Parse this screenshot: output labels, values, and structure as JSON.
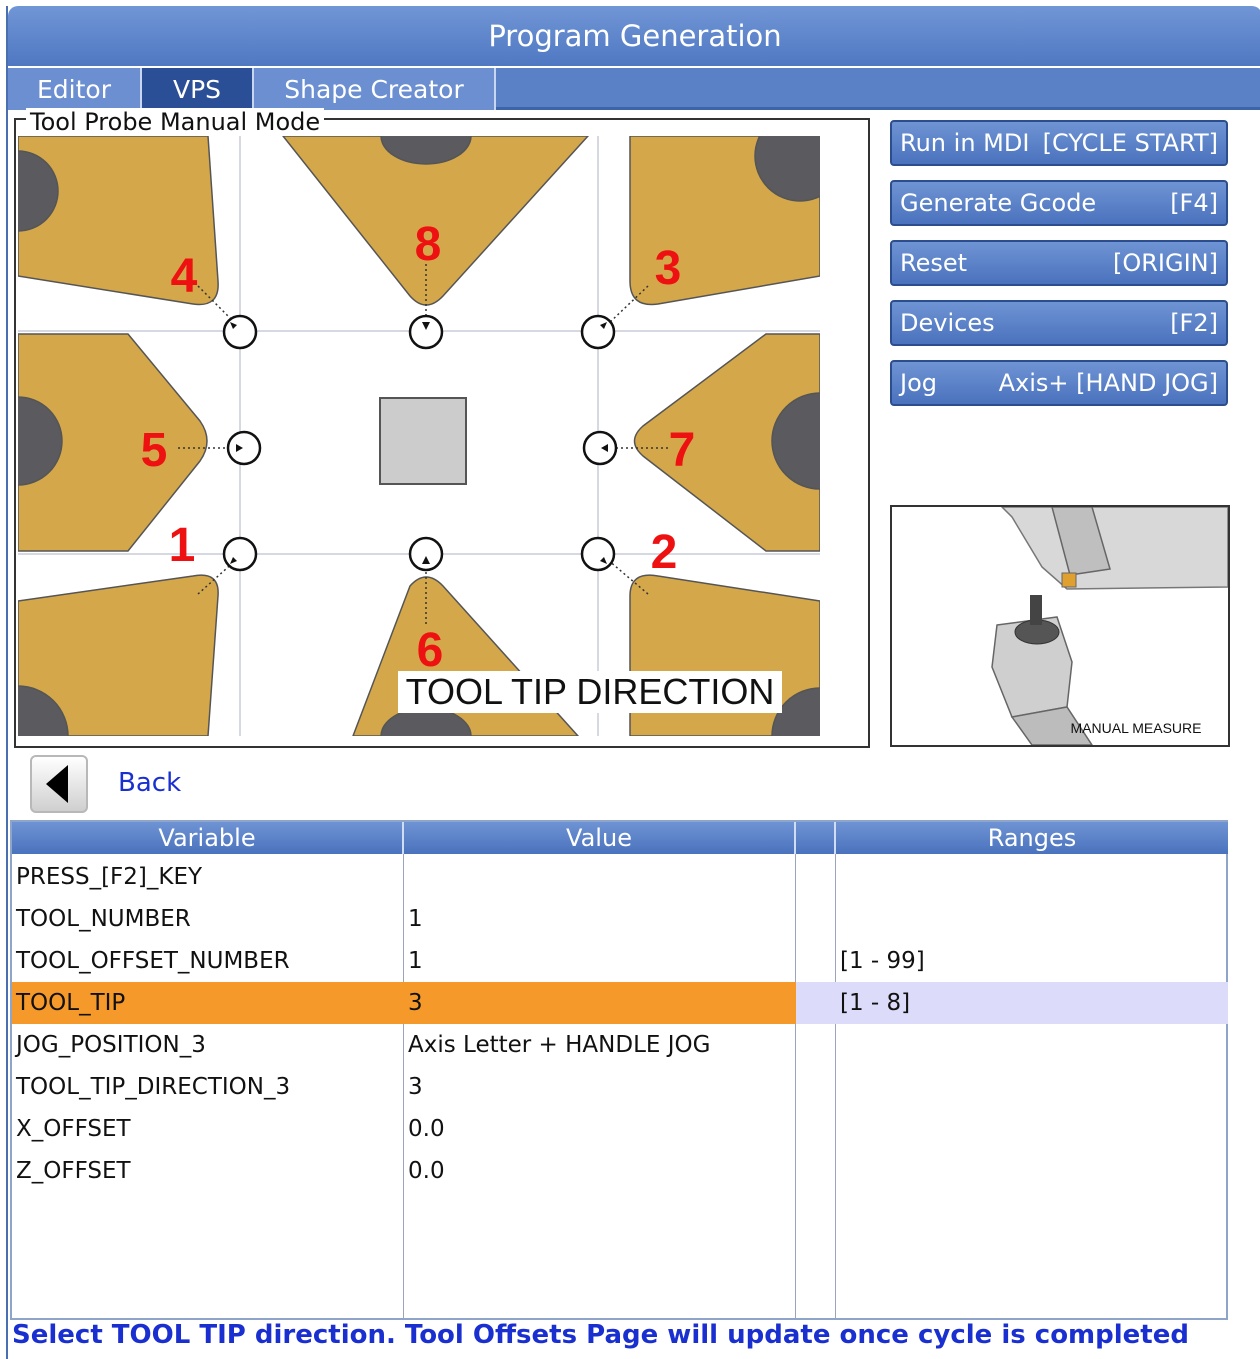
{
  "window": {
    "title": "Program Generation"
  },
  "tabs": [
    {
      "label": "Editor"
    },
    {
      "label": "VPS",
      "active": true
    },
    {
      "label": "Shape Creator"
    }
  ],
  "panel": {
    "title": "Tool Probe Manual Mode"
  },
  "diagram": {
    "caption": "TOOL TIP DIRECTION",
    "tip_numbers": [
      "1",
      "2",
      "3",
      "4",
      "5",
      "6",
      "7",
      "8"
    ],
    "insert_color": "#d4a84a",
    "number_color": "#ee1111"
  },
  "buttons": [
    {
      "label": "Run in MDI",
      "key": "[CYCLE START]"
    },
    {
      "label": "Generate Gcode",
      "key": "[F4]"
    },
    {
      "label": "Reset",
      "key": "[ORIGIN]"
    },
    {
      "label": "Devices",
      "key": "[F2]"
    },
    {
      "label": "Jog",
      "key": "Axis+ [HAND JOG]"
    }
  ],
  "photo": {
    "caption": "MANUAL MEASURE"
  },
  "nav": {
    "back_label": "Back"
  },
  "table": {
    "headers": {
      "variable": "Variable",
      "value": "Value",
      "extra": "",
      "ranges": "Ranges"
    },
    "rows": [
      {
        "variable": "PRESS_[F2]_KEY",
        "value": "",
        "range": ""
      },
      {
        "variable": "TOOL_NUMBER",
        "value": "1",
        "range": ""
      },
      {
        "variable": "TOOL_OFFSET_NUMBER",
        "value": "1",
        "range": "[1 - 99]"
      },
      {
        "variable": "TOOL_TIP",
        "value": "3",
        "range": "[1 - 8]",
        "selected": true
      },
      {
        "variable": "JOG_POSITION_3",
        "value": "Axis Letter + HANDLE JOG",
        "range": ""
      },
      {
        "variable": "TOOL_TIP_DIRECTION_3",
        "value": "3",
        "range": ""
      },
      {
        "variable": "X_OFFSET",
        "value": "0.0",
        "range": ""
      },
      {
        "variable": "Z_OFFSET",
        "value": "0.0",
        "range": ""
      }
    ]
  },
  "status": {
    "text": "Select TOOL TIP direction. Tool Offsets Page will update once cycle is completed"
  },
  "colors": {
    "accent": "#4f78c2",
    "selected_row": "#f59a2a",
    "selected_range": "#dcdcfa",
    "link": "#1a2fd0"
  }
}
